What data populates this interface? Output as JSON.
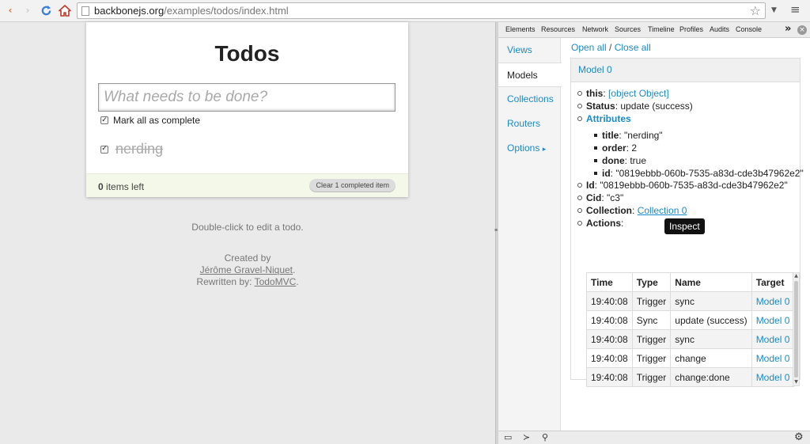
{
  "browser": {
    "url_host": "backbonejs.org",
    "url_path": "/examples/todos/index.html"
  },
  "todo": {
    "title": "Todos",
    "placeholder": "What needs to be done?",
    "mark_all_label": "Mark all as complete",
    "items": [
      {
        "title": "nerding",
        "done": true
      }
    ],
    "items_left_count": "0",
    "items_left_text": " items left",
    "clear_label": "Clear 1 completed item",
    "hint": "Double-click to edit a todo.",
    "created_by": "Created by",
    "author": "Jérôme Gravel-Niquet",
    "author_suffix": ".",
    "rewritten_by": "Rewritten by: ",
    "rewriter": "TodoMVC",
    "rewriter_suffix": "."
  },
  "devtools": {
    "tabs": [
      "Elements",
      "Resources",
      "Network",
      "Sources",
      "Timeline",
      "Profiles",
      "Audits",
      "Console"
    ],
    "more": "»",
    "close": "×"
  },
  "backbone": {
    "sidebar": [
      "Views",
      "Models",
      "Collections",
      "Routers",
      "Options"
    ],
    "options_arrow": "▸",
    "open_all": "Open all",
    "slash": " / ",
    "close_all": "Close all",
    "panel_title": "Model 0",
    "this_key": "this",
    "this_val": "[object Object]",
    "status_key": "Status",
    "status_val": "update (success)",
    "attributes_key": "Attributes",
    "attributes": [
      {
        "key": "title",
        "val": "\"nerding\""
      },
      {
        "key": "order",
        "val": "2"
      },
      {
        "key": "done",
        "val": "true"
      },
      {
        "key": "id",
        "val": "\"0819ebbb-060b-7535-a83d-cde3b47962e2\""
      }
    ],
    "id_key": "Id",
    "id_val": "\"0819ebbb-060b-7535-a83d-cde3b47962e2\"",
    "cid_key": "Cid",
    "cid_val": "\"c3\"",
    "collection_key": "Collection",
    "collection_val": "Collection 0",
    "actions_key": "Actions",
    "tooltip": "Inspect",
    "actions_columns": [
      "Time",
      "Type",
      "Name",
      "Target"
    ],
    "actions": [
      {
        "time": "19:40:08",
        "type": "Trigger",
        "name": "sync",
        "target": "Model 0"
      },
      {
        "time": "19:40:08",
        "type": "Sync",
        "name": "update (success)",
        "target": "Model 0"
      },
      {
        "time": "19:40:08",
        "type": "Trigger",
        "name": "sync",
        "target": "Model 0"
      },
      {
        "time": "19:40:08",
        "type": "Trigger",
        "name": "change",
        "target": "Model 0"
      },
      {
        "time": "19:40:08",
        "type": "Trigger",
        "name": "change:done",
        "target": "Model 0"
      }
    ]
  },
  "colors": {
    "link": "#1a8ac7",
    "footer_bg": "#f3f8e8"
  }
}
